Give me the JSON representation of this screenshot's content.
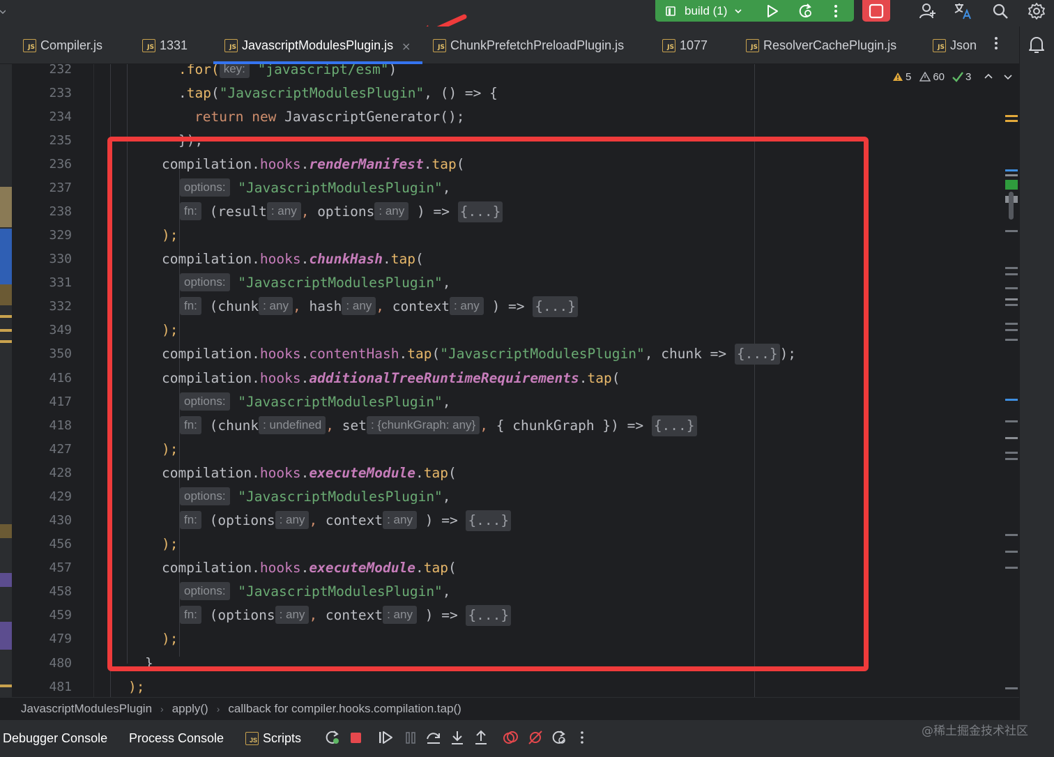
{
  "toolbar": {
    "run_config": "build (1)",
    "accent_color": "#3e9a4a",
    "stop_color": "#e5484d"
  },
  "tabs": [
    {
      "label": "Compiler.js",
      "active": false
    },
    {
      "label": "1331",
      "active": false
    },
    {
      "label": "JavascriptModulesPlugin.js",
      "active": true
    },
    {
      "label": "ChunkPrefetchPreloadPlugin.js",
      "active": false
    },
    {
      "label": "1077",
      "active": false
    },
    {
      "label": "ResolverCachePlugin.js",
      "active": false
    },
    {
      "label": "Json",
      "active": false
    }
  ],
  "tab_close": "×",
  "inspections": {
    "warnings": "5",
    "weak_warnings": "60",
    "typos": "3"
  },
  "gutter": {
    "line_numbers": [
      "232",
      "233",
      "234",
      "235",
      "236",
      "237",
      "238",
      "329",
      "330",
      "331",
      "332",
      "349",
      "350",
      "416",
      "417",
      "418",
      "427",
      "428",
      "429",
      "430",
      "456",
      "457",
      "458",
      "459",
      "479",
      "480",
      "481"
    ]
  },
  "code": {
    "l232_a": ".for(",
    "l232_hint": "key:",
    "l232_str": "\"javascript/esm\"",
    "l232_b": ")",
    "l233_a": ".",
    "l233_fn": "tap",
    "l233_b": "(",
    "l233_str": "\"JavascriptModulesPlugin\"",
    "l233_c": ", () => {",
    "l234_kw1": "return",
    "l234_kw2": "new",
    "l234_rest": " JavascriptGenerator();",
    "l235": "});",
    "comp": "compilation",
    "dot": ".",
    "hooks": "hooks",
    "tap": "tap",
    "open": "(",
    "close": ");",
    "comma": ",",
    "options_hint": "options:",
    "plugin_str": "\"JavascriptModulesPlugin\"",
    "fn_hint": "fn:",
    "arrow": ") =>",
    "folded": "{...}",
    "any_hint": ": any",
    "undef_hint": ": undefined",
    "cg_hint": ": {chunkGraph: any}",
    "h1_name": "renderManifest",
    "h1_p1": "(result",
    "h1_p2": " options",
    "h2_name": "chunkHash",
    "h2_p1": "(chunk",
    "h2_p2": " hash",
    "h2_p3": " context",
    "h3_name": "contentHash",
    "h3_rest": ", chunk => ",
    "h3_end": ");",
    "h4_name": "additionalTreeRuntimeRequirements",
    "h4_p1": "(chunk",
    "h4_p2": " set",
    "h4_p3": " { chunkGraph }) =>",
    "h5_name": "executeModule",
    "h5_p1": "(options",
    "h5_p2": " context",
    "l480": "}",
    "l481": ");"
  },
  "breadcrumb": [
    "JavascriptModulesPlugin",
    "apply()",
    "callback for compiler.hooks.compilation.tap()"
  ],
  "debug": {
    "debugger_console": "Debugger Console",
    "process_console": "Process Console",
    "scripts": "Scripts"
  },
  "watermark": "@稀土掘金技术社区",
  "annotation_color": "#ef3b3b"
}
